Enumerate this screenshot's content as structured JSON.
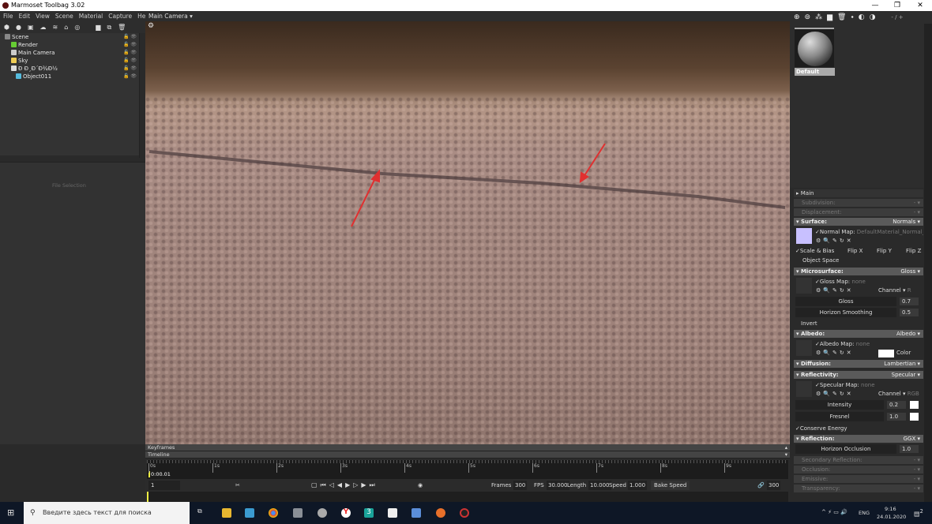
{
  "window": {
    "title": "Marmoset Toolbag 3.02",
    "minimize": "—",
    "maximize": "❐",
    "close": "✕"
  },
  "menu": [
    "File",
    "Edit",
    "View",
    "Scene",
    "Material",
    "Capture",
    "Help"
  ],
  "scene_tree": [
    {
      "label": "Scene",
      "color": "#888"
    },
    {
      "label": "Render",
      "color": "#6c3"
    },
    {
      "label": "Main Camera",
      "color": "#ccc"
    },
    {
      "label": "Sky",
      "color": "#ec5"
    },
    {
      "label": "Ð Ð¸Ð´Ð¾Ð½",
      "color": "#ddd"
    },
    {
      "label": "Object011",
      "color": "#5bd"
    }
  ],
  "file_selection": "File Selection",
  "viewport": {
    "camera": "Main Camera ▾"
  },
  "material": {
    "name": "Default",
    "page": "- / +"
  },
  "props": {
    "main": "Main",
    "subdivision": "Subdivision:",
    "displacement": "Displacement:",
    "dash": "- ▾",
    "surface": {
      "label": "Surface:",
      "value": "Normals ▾",
      "normal_map": "✓Normal Map:",
      "normal_file": "DefaultMaterial_Normal_D",
      "scale_bias": "✓Scale & Bias",
      "flip_x": "Flip X",
      "flip_y": "Flip Y",
      "flip_z": "Flip Z",
      "object_space": "Object Space",
      "swatch": "#c8c0ff"
    },
    "microsurface": {
      "label": "Microsurface:",
      "value": "Gloss ▾",
      "map": "✓Gloss Map:",
      "none": "none",
      "channel": "Channel ▾",
      "channel_val": "R",
      "gloss": "Gloss",
      "gloss_val": "0.7",
      "horizon": "Horizon Smoothing",
      "horizon_val": "0.5",
      "invert": "Invert"
    },
    "albedo": {
      "label": "Albedo:",
      "value": "Albedo ▾",
      "map": "✓Albedo Map:",
      "none": "none",
      "color": "Color"
    },
    "diffusion": {
      "label": "Diffusion:",
      "value": "Lambertian ▾"
    },
    "reflectivity": {
      "label": "Reflectivity:",
      "value": "Specular ▾",
      "map": "✓Specular Map:",
      "none": "none",
      "channel": "Channel ▾",
      "channel_val": "RGB",
      "intensity": "Intensity",
      "intensity_val": "0.2",
      "fresnel": "Fresnel",
      "fresnel_val": "1.0",
      "conserve": "✓Conserve Energy"
    },
    "reflection": {
      "label": "Reflection:",
      "value": "GGX ▾",
      "occlusion": "Horizon Occlusion",
      "occlusion_val": "1.0"
    },
    "secondary": "Secondary Reflection:",
    "occlusion": "Occlusion:",
    "emissive": "Emissive:",
    "transparency": "Transparency:"
  },
  "timeline": {
    "keyframes": "Keyframes",
    "timeline": "Timeline",
    "time": "0:00.01",
    "ticks": [
      "0s",
      "1s",
      "2s",
      "3s",
      "4s",
      "5s",
      "6s",
      "7s",
      "8s",
      "9s"
    ],
    "frame": "1",
    "frames_label": "Frames",
    "frames": "300",
    "fps_label": "FPS",
    "fps": "30.000",
    "length_label": "Length",
    "length": "10.000",
    "speed_label": "Speed",
    "speed": "1.000",
    "bake_speed": "Bake Speed",
    "end_frame": "300"
  },
  "taskbar": {
    "search_placeholder": "Введите здесь текст для поиска",
    "lang": "ENG",
    "time": "9:16",
    "date": "24.01.2020",
    "notif": "2"
  }
}
